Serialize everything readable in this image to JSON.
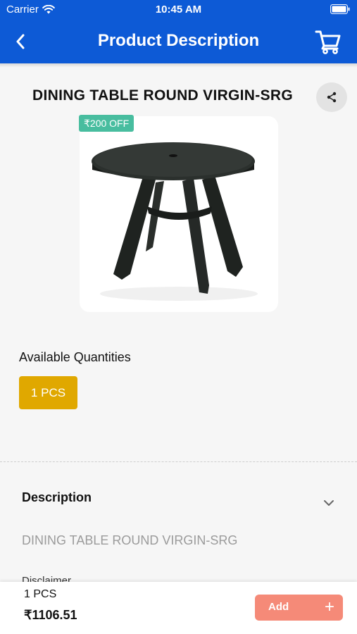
{
  "status_bar": {
    "carrier": "Carrier",
    "time": "10:45 AM"
  },
  "header": {
    "title": "Product Description"
  },
  "product": {
    "name": "DINING TABLE ROUND VIRGIN-SRG",
    "discount_badge": "₹200 OFF"
  },
  "quantities": {
    "label": "Available Quantities",
    "options": [
      "1 PCS"
    ]
  },
  "description": {
    "heading": "Description",
    "text": "DINING TABLE ROUND VIRGIN-SRG",
    "disclaimer_label": "Disclaimer"
  },
  "cart_bar": {
    "qty": "1 PCS",
    "price": "₹1106.51",
    "add_label": "Add",
    "add_icon": "+"
  },
  "colors": {
    "primary": "#0d5ad6",
    "badge": "#48bd9f",
    "chip": "#e0a800",
    "add_button": "#f58a78"
  }
}
